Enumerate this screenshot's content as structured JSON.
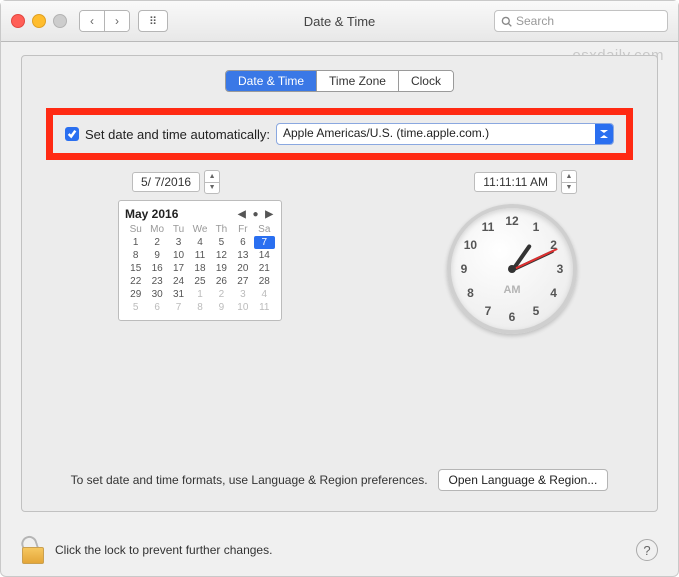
{
  "window": {
    "title": "Date & Time"
  },
  "search": {
    "placeholder": "Search"
  },
  "watermark": "osxdaily.com",
  "tabs": {
    "t1": "Date & Time",
    "t2": "Time Zone",
    "t3": "Clock"
  },
  "auto": {
    "label": "Set date and time automatically:",
    "server": "Apple Americas/U.S. (time.apple.com.)"
  },
  "date_field": "5/  7/2016",
  "time_field": "11:11:11 AM",
  "calendar": {
    "title": "May 2016",
    "dow": [
      "Su",
      "Mo",
      "Tu",
      "We",
      "Th",
      "Fr",
      "Sa"
    ],
    "cells": [
      {
        "v": "1"
      },
      {
        "v": "2"
      },
      {
        "v": "3"
      },
      {
        "v": "4"
      },
      {
        "v": "5"
      },
      {
        "v": "6"
      },
      {
        "v": "7",
        "sel": true
      },
      {
        "v": "8"
      },
      {
        "v": "9"
      },
      {
        "v": "10"
      },
      {
        "v": "11"
      },
      {
        "v": "12"
      },
      {
        "v": "13"
      },
      {
        "v": "14"
      },
      {
        "v": "15"
      },
      {
        "v": "16"
      },
      {
        "v": "17"
      },
      {
        "v": "18"
      },
      {
        "v": "19"
      },
      {
        "v": "20"
      },
      {
        "v": "21"
      },
      {
        "v": "22"
      },
      {
        "v": "23"
      },
      {
        "v": "24"
      },
      {
        "v": "25"
      },
      {
        "v": "26"
      },
      {
        "v": "27"
      },
      {
        "v": "28"
      },
      {
        "v": "29"
      },
      {
        "v": "30"
      },
      {
        "v": "31"
      },
      {
        "v": "1",
        "out": true
      },
      {
        "v": "2",
        "out": true
      },
      {
        "v": "3",
        "out": true
      },
      {
        "v": "4",
        "out": true
      },
      {
        "v": "5",
        "out": true
      },
      {
        "v": "6",
        "out": true
      },
      {
        "v": "7",
        "out": true
      },
      {
        "v": "8",
        "out": true
      },
      {
        "v": "9",
        "out": true
      },
      {
        "v": "10",
        "out": true
      },
      {
        "v": "11",
        "out": true
      }
    ]
  },
  "clock": {
    "ampm": "AM",
    "numbers": [
      "12",
      "1",
      "2",
      "3",
      "4",
      "5",
      "6",
      "7",
      "8",
      "9",
      "10",
      "11"
    ],
    "hour_angle": -55,
    "minute_angle": -25,
    "second_angle": -25
  },
  "formats_hint": "To set date and time formats, use Language & Region preferences.",
  "open_lr": "Open Language & Region...",
  "lock_text": "Click the lock to prevent further changes.",
  "help": "?"
}
